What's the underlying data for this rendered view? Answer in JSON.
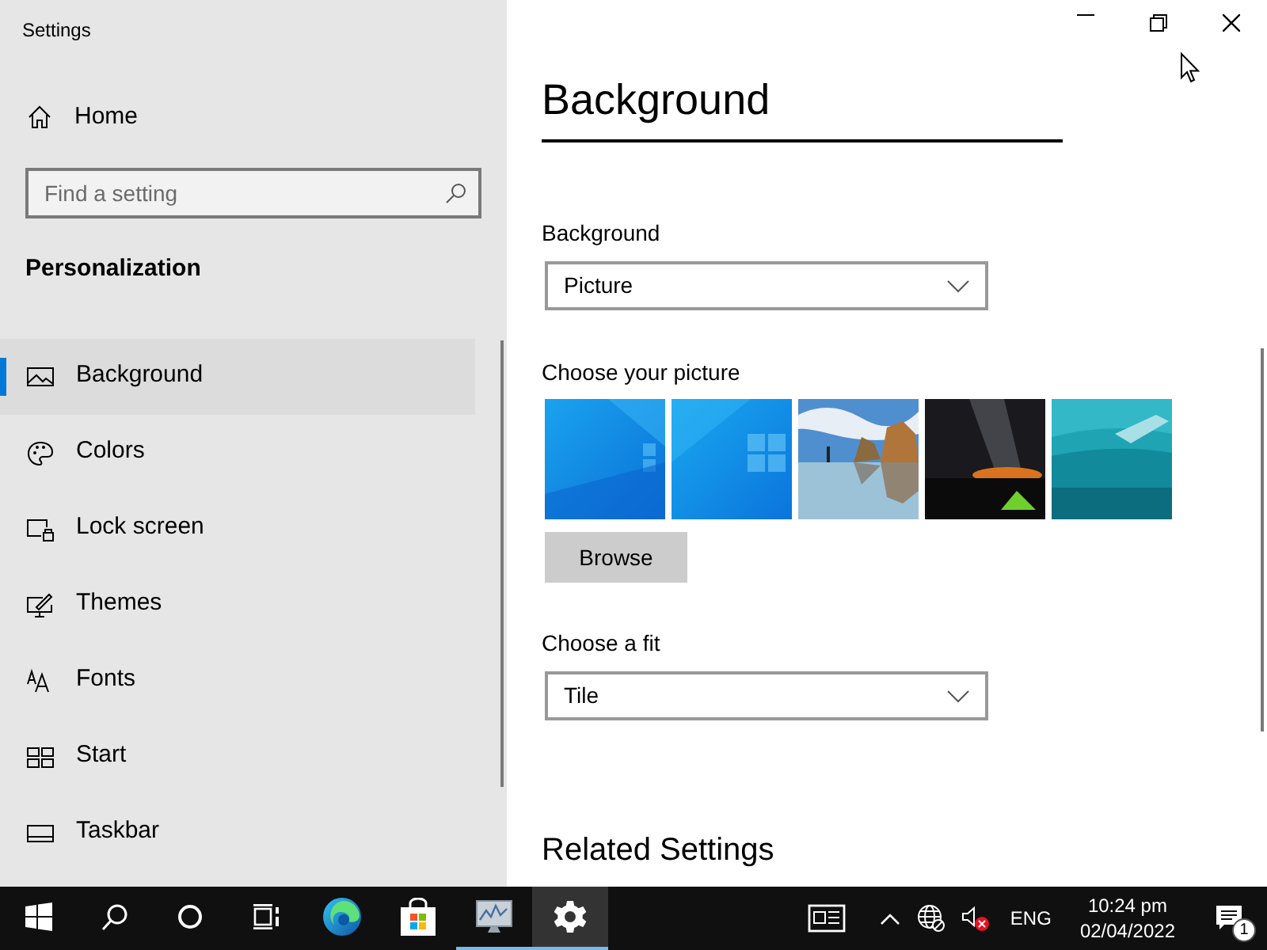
{
  "window": {
    "title": "Settings"
  },
  "sidebar": {
    "home": "Home",
    "search": {
      "placeholder": "Find a setting"
    },
    "section": "Personalization",
    "items": [
      {
        "label": "Background",
        "selected": true
      },
      {
        "label": "Colors",
        "selected": false
      },
      {
        "label": "Lock screen",
        "selected": false
      },
      {
        "label": "Themes",
        "selected": false
      },
      {
        "label": "Fonts",
        "selected": false
      },
      {
        "label": "Start",
        "selected": false
      },
      {
        "label": "Taskbar",
        "selected": false
      }
    ]
  },
  "page": {
    "title": "Background",
    "background": {
      "label": "Background",
      "value": "Picture"
    },
    "pictures": {
      "label": "Choose your picture"
    },
    "browse": "Browse",
    "fit": {
      "label": "Choose a fit",
      "value": "Tile"
    },
    "related": "Related Settings"
  },
  "taskbar": {
    "buttons": [
      {
        "selected": false,
        "running": false
      },
      {
        "selected": false,
        "running": false
      },
      {
        "selected": false,
        "running": false
      },
      {
        "selected": false,
        "running": false
      },
      {
        "selected": false,
        "running": false
      },
      {
        "selected": false,
        "running": false
      },
      {
        "selected": false,
        "running": true
      },
      {
        "selected": true,
        "running": true
      }
    ],
    "tray": {
      "muted": true,
      "language": "ENG",
      "time": "10:24 pm",
      "date": "02/04/2022",
      "notifications": "1"
    }
  }
}
